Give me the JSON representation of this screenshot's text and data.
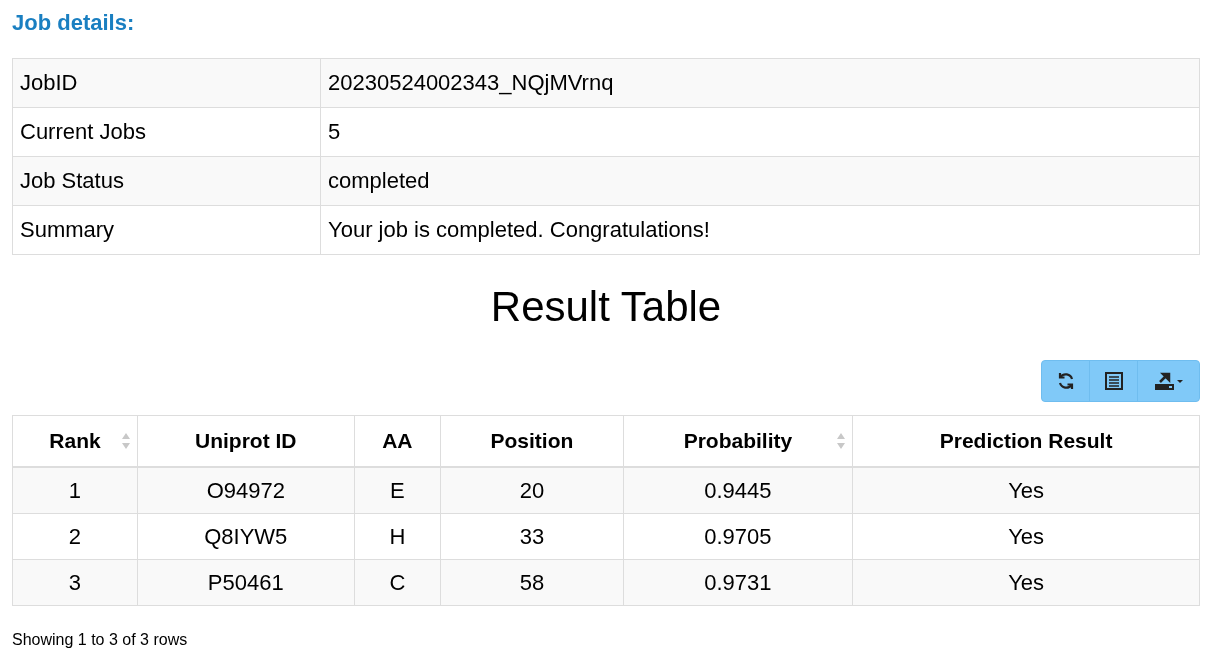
{
  "heading": "Job details:",
  "details": [
    {
      "label": "JobID",
      "value": "20230524002343_NQjMVrnq"
    },
    {
      "label": "Current Jobs",
      "value": "5"
    },
    {
      "label": "Job Status",
      "value": "completed"
    },
    {
      "label": "Summary",
      "value": "Your job is completed. Congratulations!"
    }
  ],
  "result_title": "Result Table",
  "toolbar": [
    {
      "kind": "refresh"
    },
    {
      "kind": "columns"
    },
    {
      "kind": "export"
    }
  ],
  "table": {
    "columns": [
      {
        "label": "Rank",
        "sortable": true
      },
      {
        "label": "Uniprot ID",
        "sortable": false
      },
      {
        "label": "AA",
        "sortable": false
      },
      {
        "label": "Position",
        "sortable": false
      },
      {
        "label": "Probability",
        "sortable": true
      },
      {
        "label": "Prediction Result",
        "sortable": false
      }
    ],
    "rows": [
      [
        "1",
        "O94972",
        "E",
        "20",
        "0.9445",
        "Yes"
      ],
      [
        "2",
        "Q8IYW5",
        "H",
        "33",
        "0.9705",
        "Yes"
      ],
      [
        "3",
        "P50461",
        "C",
        "58",
        "0.9731",
        "Yes"
      ]
    ]
  },
  "footer": "Showing 1 to 3 of 3 rows"
}
